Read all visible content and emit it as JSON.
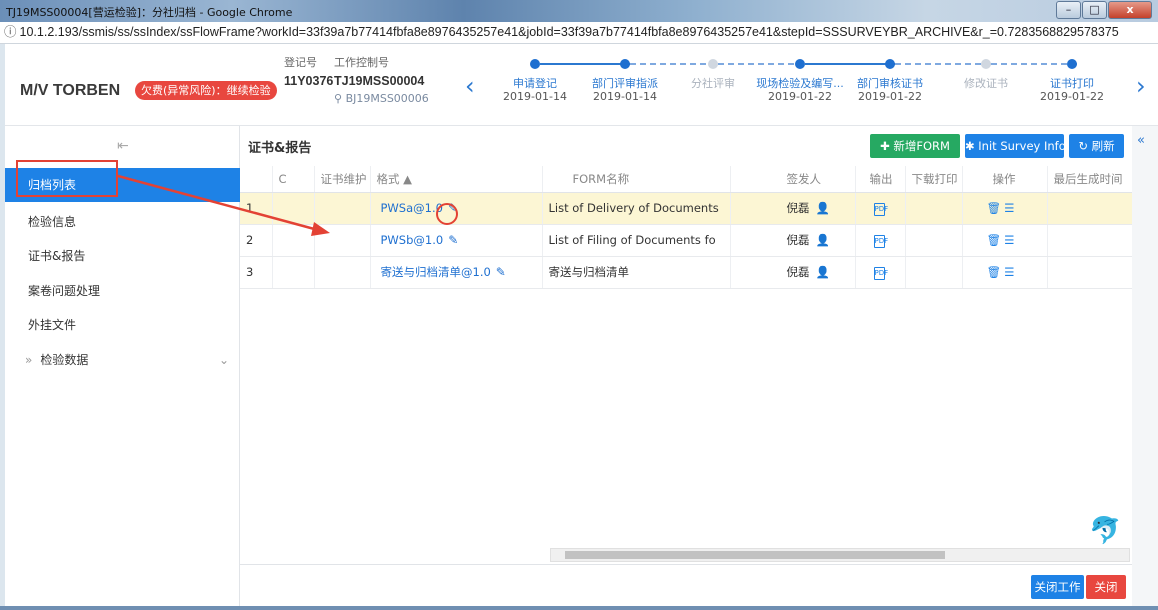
{
  "window": {
    "title": "TJ19MSS00004[营运检验]：分社归档 - Google Chrome",
    "min": "–",
    "max": "□",
    "close": "x"
  },
  "address": {
    "info": "ⓘ",
    "url": "10.1.2.193/ssmis/ss/ssIndex/ssFlowFrame?workId=33f39a7b77414fbfa8e8976435257e41&jobId=33f39a7b77414fbfa8e8976435257e41&stepId=SSSURVEYBR_ARCHIVE&r_=0.7283568829578375"
  },
  "header": {
    "ship": "M/V TORBEN",
    "risk": "欠费(异常风险)：继续检验",
    "reg_label": "登记号",
    "reg_value": "11Y0376",
    "job_label": "工作控制号",
    "job_value": "TJ19MSS00004",
    "job_sub": "BJ19MSS00006",
    "prev": "‹",
    "next": "›",
    "steps": [
      {
        "label": "申请登记",
        "date": "2019-01-14",
        "state": "done"
      },
      {
        "label": "部门评审指派",
        "date": "2019-01-14",
        "state": "done"
      },
      {
        "label": "分社评审",
        "date": "",
        "state": "skipped"
      },
      {
        "label": "现场检验及编写...",
        "date": "2019-01-22",
        "state": "done"
      },
      {
        "label": "部门审核证书",
        "date": "2019-01-22",
        "state": "done"
      },
      {
        "label": "修改证书",
        "date": "",
        "state": "skipped"
      },
      {
        "label": "证书打印",
        "date": "2019-01-22",
        "state": "done"
      }
    ]
  },
  "sidebar": {
    "collapse": "⇤",
    "items": [
      {
        "label": "归档列表",
        "active": true
      },
      {
        "label": "检验信息"
      },
      {
        "label": "证书&报告"
      },
      {
        "label": "案卷问题处理"
      },
      {
        "label": "外挂文件"
      },
      {
        "label": "检验数据",
        "prefix": "»",
        "suffix": "⌄"
      }
    ]
  },
  "content": {
    "title": "证书&报告",
    "btn_new": "✚ 新增FORM",
    "btn_init": "✱ Init Survey Info",
    "btn_refresh": "↻ 刷新",
    "collapse_right": "«",
    "columns": [
      "",
      "C",
      "证书维护",
      "格式 ▲",
      "FORM名称",
      "签发人",
      "输出",
      "下载打印",
      "操作",
      "最后生成时间"
    ],
    "rows": [
      {
        "no": "1",
        "format": "PWSa@1.0",
        "form": "List of Delivery of Documents",
        "signer": "倪磊",
        "highlight": true
      },
      {
        "no": "2",
        "format": "PWSb@1.0",
        "form": "List of Filing of Documents fo",
        "signer": "倪磊"
      },
      {
        "no": "3",
        "format": "寄送与归档清单@1.0",
        "form": "寄送与归档清单",
        "signer": "倪磊"
      }
    ],
    "pdf_label": "PDF",
    "ops": "🗑☰",
    "btn_closework": "关闭工作",
    "btn_close": "关闭"
  }
}
